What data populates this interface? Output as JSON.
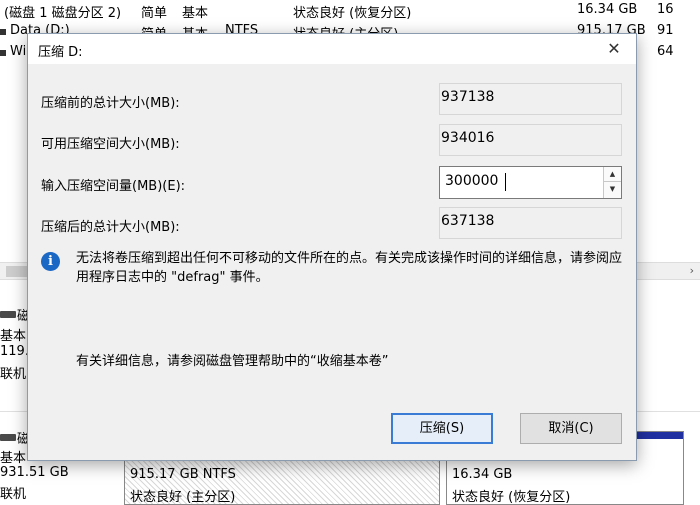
{
  "volumes": [
    {
      "name": "(磁盘 1 磁盘分区 2)",
      "layout": "简单",
      "type": "基本",
      "fs": "",
      "status": "状态良好 (恢复分区)",
      "capacity": "16.34 GB",
      "free": "16"
    },
    {
      "name": "Data (D:)",
      "layout": "简单",
      "type": "基本",
      "fs": "NTFS",
      "status": "状态良好 (主分区)",
      "capacity": "915.17 GB",
      "free": "91"
    },
    {
      "name": "Wi",
      "layout": "",
      "type": "",
      "fs": "",
      "status": "",
      "capacity": "",
      "free": "64"
    }
  ],
  "disk0": {
    "label": "磁",
    "type": "基本",
    "size": "119.",
    "state": "联机"
  },
  "disk1": {
    "label": "磁",
    "type": "基本",
    "size": "931.51 GB",
    "state": "联机"
  },
  "partitions": [
    {
      "size": "915.17 GB NTFS",
      "status": "状态良好 (主分区)"
    },
    {
      "size": "16.34 GB",
      "status": "状态良好 (恢复分区)"
    }
  ],
  "dialog": {
    "title": "压缩 D:",
    "close_glyph": "✕",
    "fields": [
      {
        "label": "压缩前的总计大小(MB):",
        "value": "937138"
      },
      {
        "label": "可用压缩空间大小(MB):",
        "value": "934016"
      },
      {
        "label": "输入压缩空间量(MB)(E):",
        "value": "300000"
      },
      {
        "label": "压缩后的总计大小(MB):",
        "value": "637138"
      }
    ],
    "info_icon": "info-icon",
    "info_text": "无法将卷压缩到超出任何不可移动的文件所在的点。有关完成该操作时间的详细信息，请参阅应用程序日志中的 \"defrag\" 事件。",
    "help_text": "有关详细信息，请参阅磁盘管理帮助中的“收缩基本卷”",
    "shrink_button": "压缩(S)",
    "cancel_button": "取消(C)"
  },
  "colors": {
    "accent": "#3a7bd5",
    "info": "#1a67c4",
    "partition_stripe": "#2030a0"
  }
}
